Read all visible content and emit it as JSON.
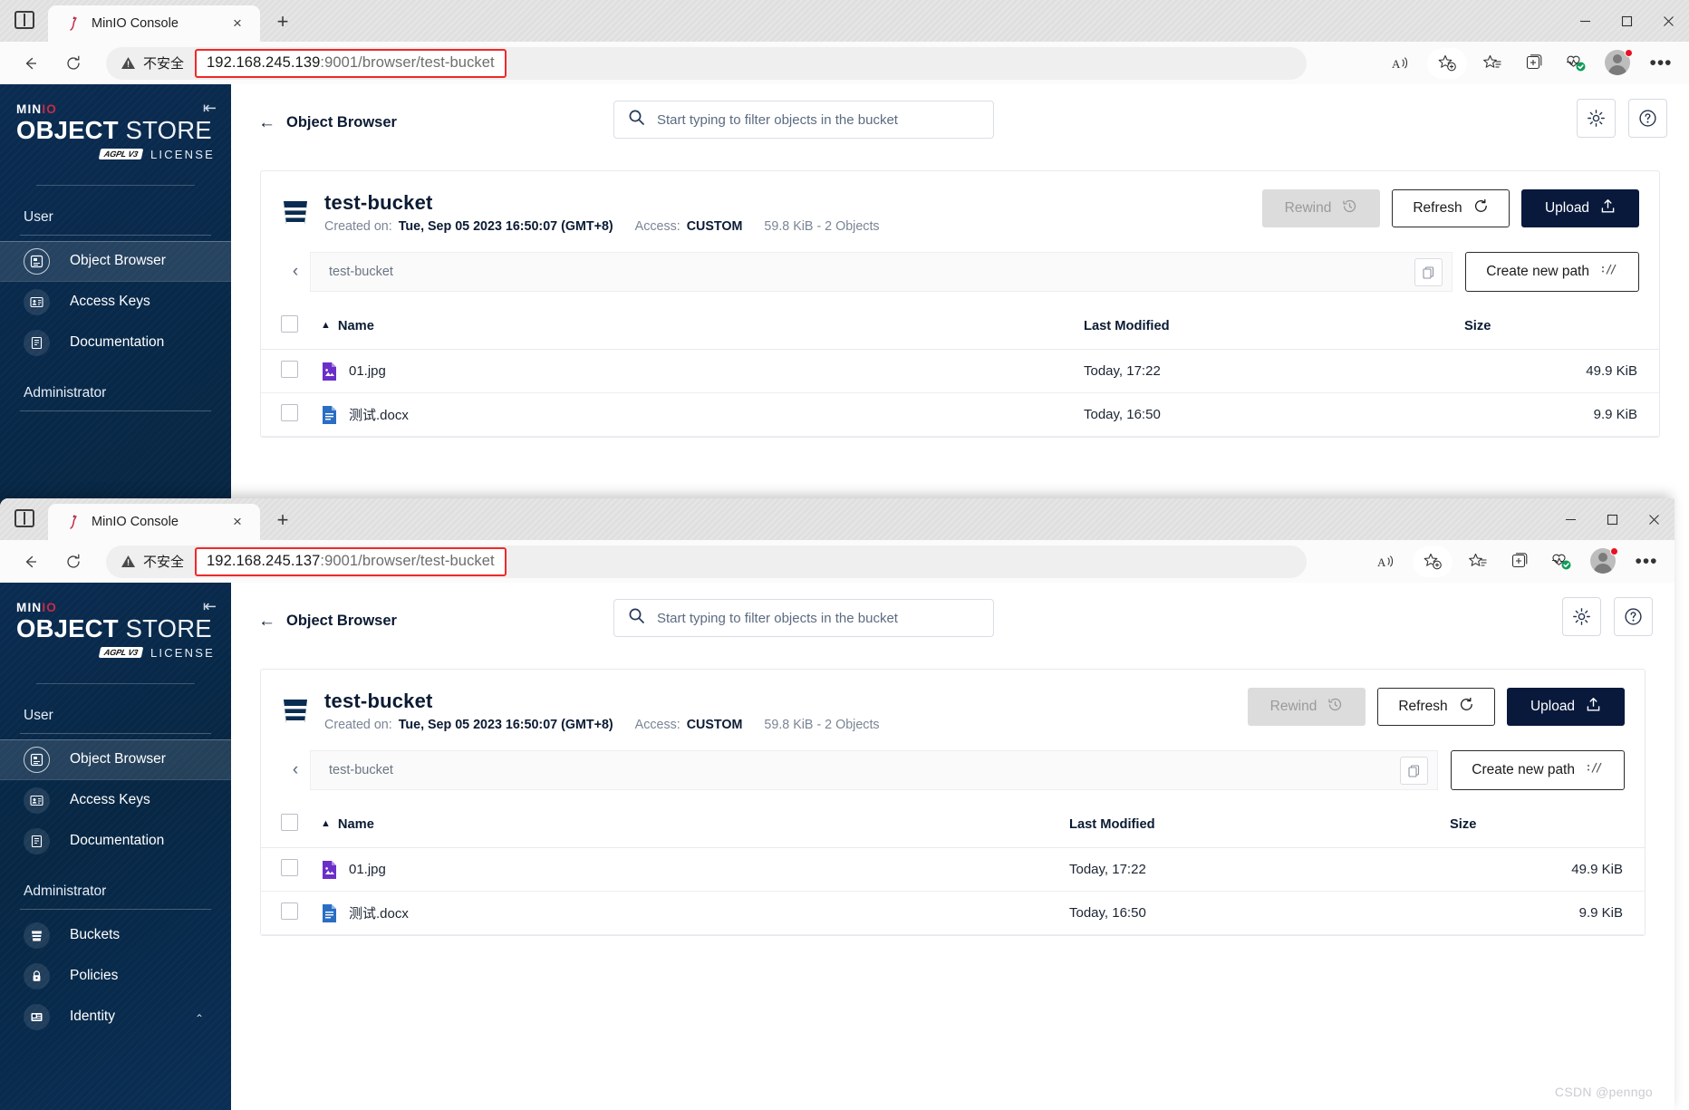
{
  "windows": [
    {
      "id": "back-window",
      "tab": {
        "title": "MinIO Console",
        "favicon": "minio-flamingo-icon",
        "close_label": "×",
        "new_tab_label": "+"
      },
      "address": {
        "security_label": "不安全",
        "host": "192.168.245.139",
        "rest": ":9001/browser/test-bucket"
      },
      "controls": {
        "minimize": "minimize-icon",
        "maximize": "maximize-icon",
        "close": "close-icon"
      }
    },
    {
      "id": "front-window",
      "tab": {
        "title": "MinIO Console",
        "favicon": "minio-flamingo-icon",
        "close_label": "×",
        "new_tab_label": "+"
      },
      "address": {
        "security_label": "不安全",
        "host": "192.168.245.137",
        "rest": ":9001/browser/test-bucket"
      },
      "controls": {
        "minimize": "minimize-icon",
        "maximize": "maximize-icon",
        "close": "close-icon"
      }
    }
  ],
  "sidebar": {
    "logo": {
      "brand_top": "MIN",
      "brand_top_accent": "IO",
      "line1_bold": "OBJECT",
      "line1_light": "STORE",
      "badge": "AGPL V3",
      "license": "LICENSE"
    },
    "collapse_icon": "collapse-sidebar-icon",
    "sections": [
      {
        "title": "User",
        "items": [
          {
            "label": "Object Browser",
            "icon": "object-browser-icon",
            "active": true
          },
          {
            "label": "Access Keys",
            "icon": "access-keys-icon",
            "active": false
          },
          {
            "label": "Documentation",
            "icon": "documentation-icon",
            "active": false
          }
        ]
      },
      {
        "title": "Administrator",
        "items": [
          {
            "label": "Buckets",
            "icon": "bucket-icon",
            "active": false
          },
          {
            "label": "Policies",
            "icon": "policy-lock-icon",
            "active": false
          },
          {
            "label": "Identity",
            "icon": "identity-icon",
            "active": false,
            "chevron": "chevron-up-icon"
          }
        ]
      }
    ]
  },
  "header": {
    "back_arrow": "←",
    "title": "Object Browser",
    "search_placeholder": "Start typing to filter objects in the bucket",
    "search_icon": "search-icon",
    "settings_icon": "gear-icon",
    "help_icon": "help-circle-icon"
  },
  "bucket": {
    "icon": "bucket-icon",
    "name": "test-bucket",
    "created_label": "Created on:",
    "created_value": "Tue, Sep 05 2023 16:50:07 (GMT+8)",
    "access_label": "Access:",
    "access_value": "CUSTOM",
    "stats": "59.8 KiB - 2 Objects",
    "actions": [
      {
        "label": "Rewind",
        "icon": "rewind-clock-icon",
        "state": "disabled"
      },
      {
        "label": "Refresh",
        "icon": "refresh-icon",
        "state": "enabled"
      },
      {
        "label": "Upload",
        "icon": "upload-icon",
        "state": "primary"
      }
    ]
  },
  "breadcrumb": {
    "back_icon": "chevron-left-icon",
    "path": "test-bucket",
    "copy_icon": "copy-icon",
    "create_path_label": "Create new path",
    "create_path_icon": "new-path-icon"
  },
  "table": {
    "select_all": "select-all-checkbox",
    "columns": [
      {
        "key": "name",
        "label": "Name",
        "sorted": "asc",
        "sort_icon": "▲"
      },
      {
        "key": "modified",
        "label": "Last Modified"
      },
      {
        "key": "size",
        "label": "Size"
      }
    ],
    "rows": [
      {
        "name": "01.jpg",
        "icon": "image-file-icon",
        "modified": "Today, 17:22",
        "size": "49.9 KiB"
      },
      {
        "name": "测试.docx",
        "icon": "word-file-icon",
        "modified": "Today, 16:50",
        "size": "9.9 KiB"
      }
    ]
  },
  "watermark": "CSDN @penngo"
}
